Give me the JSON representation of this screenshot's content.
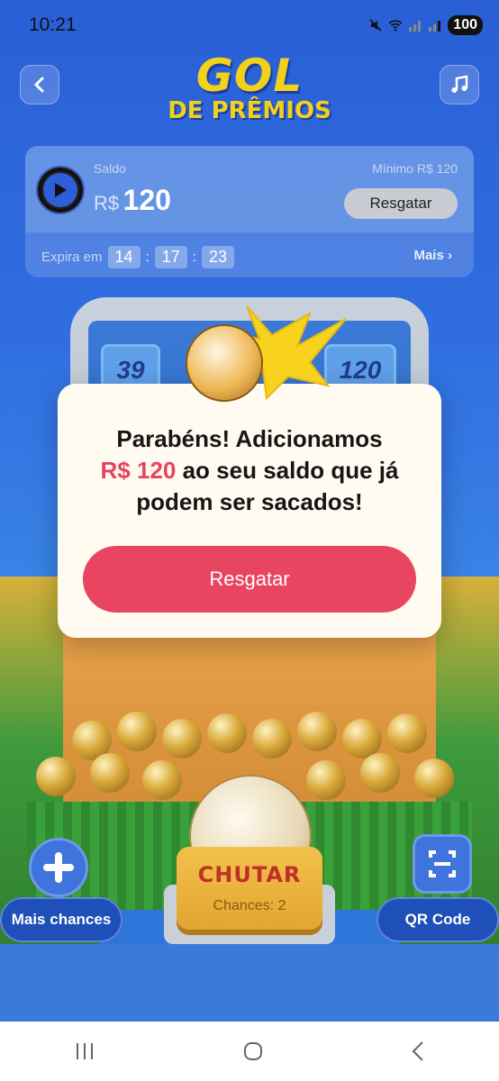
{
  "status": {
    "time": "10:21",
    "battery": "100"
  },
  "header": {
    "logo_line1": "GOL",
    "logo_line2": "DE PRÊMIOS"
  },
  "balance": {
    "saldo_label": "Saldo",
    "currency": "R$",
    "amount": "120",
    "minimo_label": "Mínimo  R$ 120",
    "resgatar": "Resgatar",
    "expira_label": "Expira em",
    "timer": [
      "14",
      "17",
      "23"
    ],
    "mais": "Mais"
  },
  "slots": [
    "39",
    "",
    "",
    "120"
  ],
  "modal": {
    "line1": "Parabéns! Adicionamos",
    "amount": "R$ 120",
    "line2_rest": " ao seu saldo que já",
    "line3": "podem ser sacados!",
    "button": "Resgatar"
  },
  "game": {
    "chutar": "CHUTAR",
    "chances": "Chances: 2",
    "mais_chances": "Mais chances",
    "qr_code": "QR Code"
  },
  "colors": {
    "accent": "#ea4560",
    "gold": "#f2d11a",
    "bg": "#2f6de0"
  }
}
